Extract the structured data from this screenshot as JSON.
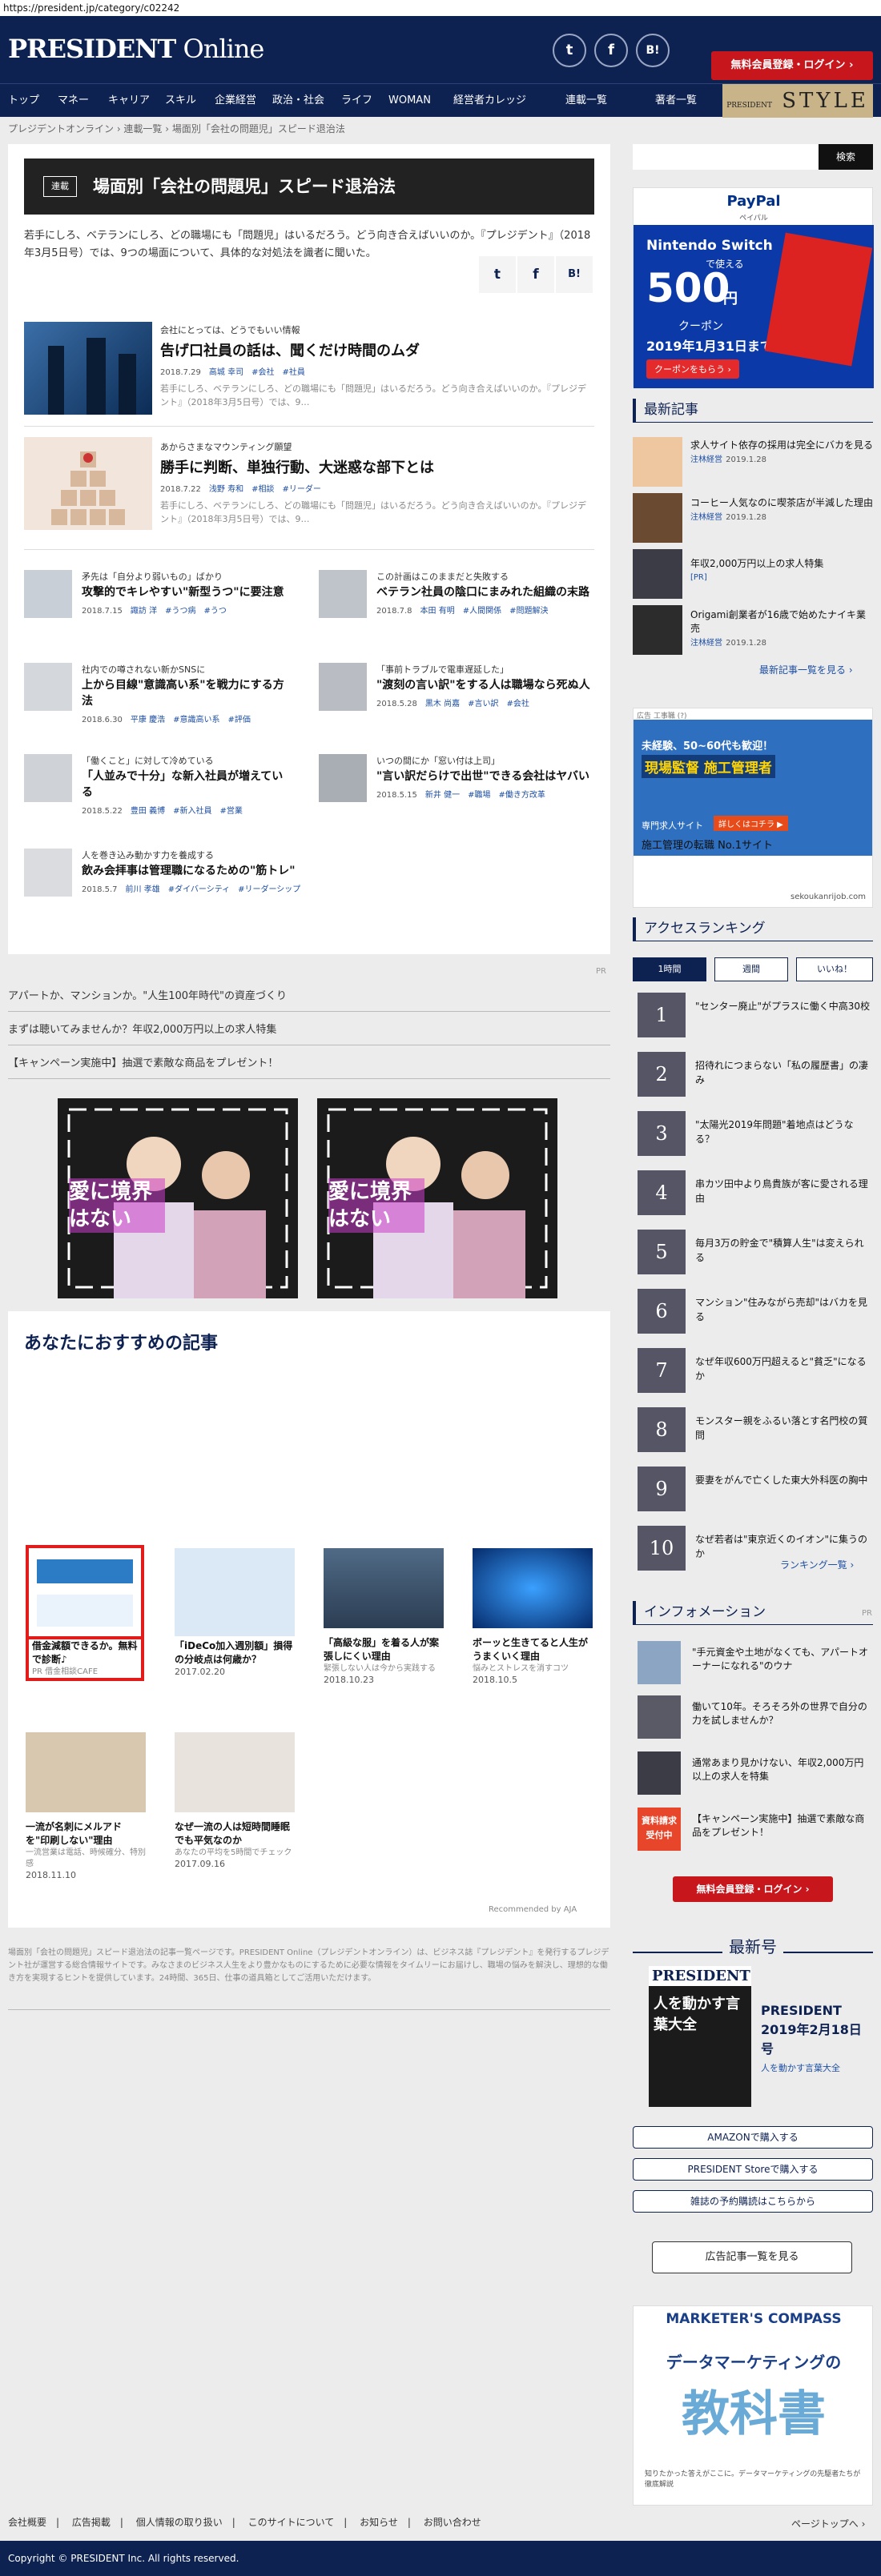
{
  "url": "https://president.jp/category/c02242",
  "header": {
    "logo_bold": "PRESIDENT",
    "logo_rest": " Online",
    "social": [
      "t",
      "f",
      "B!"
    ],
    "register": "無料会員登録・ログイン ›"
  },
  "nav": {
    "items": [
      "トップ",
      "マネー",
      "キャリア",
      "スキル",
      "企業経営",
      "政治・社会",
      "ライフ",
      "WOMAN",
      "経営者カレッジ"
    ],
    "right": [
      "連載一覧",
      "著者一覧"
    ],
    "style_small": "PRESIDENT",
    "style": "STYLE"
  },
  "breadcrumb": "プレジデントオンライン › 連載一覧 › 場面別「会社の問題児」スピード退治法",
  "series": {
    "badge": "連載",
    "title": "場面別「会社の問題児」スピード退治法",
    "lead": "若手にしろ、ベテランにしろ、どの職場にも「問題児」はいるだろう。どう向き合えばいいのか。『プレジデント』（2018年3月5日号）では、9つの場面について、具体的な対処法を識者に聞いた。",
    "share": [
      "t",
      "f",
      "B!"
    ]
  },
  "big_articles": [
    {
      "kicker": "会社にとっては、どうでもいい情報",
      "title": "告げ口社員の話は、聞くだけ時間のムダ",
      "date": "2018.7.29",
      "author": "高城 幸司",
      "tags": [
        "#会社",
        "#社員"
      ],
      "excerpt": "若手にしろ、ベテランにしろ、どの職場にも「問題児」はいるだろう。どう向き合えばいいのか。『プレジデント』（2018年3月5日号）では、9…"
    },
    {
      "kicker": "あからさまなマウンティング願望",
      "title": "勝手に判断、単独行動、大迷惑な部下とは",
      "date": "2018.7.22",
      "author": "浅野 寿和",
      "tags": [
        "#相談",
        "#リーダー"
      ],
      "excerpt": "若手にしろ、ベテランにしろ、どの職場にも「問題児」はいるだろう。どう向き合えばいいのか。『プレジデント』（2018年3月5日号）では、9…"
    }
  ],
  "small_articles": [
    {
      "kicker": "矛先は「自分より弱いもの」ばかり",
      "title": "攻撃的でキレやすい\"新型うつ\"に要注意",
      "date": "2018.7.15",
      "author": "諏訪 洋",
      "tags": [
        "#うつ病",
        "#うつ"
      ]
    },
    {
      "kicker": "この計画はこのままだと失敗する",
      "title": "ベテラン社員の陰口にまみれた組織の末路",
      "date": "2018.7.8",
      "author": "本田 有明",
      "tags": [
        "#人間関係",
        "#問題解決"
      ]
    },
    {
      "kicker": "社内での噂されない新かSNSに",
      "title": "上から目線\"意識高い系\"を戦力にする方法",
      "date": "2018.6.30",
      "author": "平康 慶浩",
      "tags": [
        "#意識高い系",
        "#評価"
      ]
    },
    {
      "kicker": "「事前トラブルで電車遅延した」",
      "title": "\"渡刻の言い訳\"をする人は職場なら死ぬ人",
      "date": "2018.5.28",
      "author": "黒木 尚嘉",
      "tags": [
        "#言い訳",
        "#会社"
      ]
    },
    {
      "kicker": "「働くこと」に対して冷めている",
      "title": "「人並みで十分」な新入社員が増えている",
      "date": "2018.5.22",
      "author": "豊田 義博",
      "tags": [
        "#新入社員",
        "#営業"
      ]
    },
    {
      "kicker": "いつの間にか「窓い付は上司」",
      "title": "\"言い訳だらけで出世\"できる会社はヤバい",
      "date": "2018.5.15",
      "author": "新井 健一",
      "tags": [
        "#職場",
        "#働き方改革"
      ]
    },
    {
      "kicker": "人を巻き込み動かす力を養成する",
      "title": "飲み会拝事は管理職になるための\"筋トレ\"",
      "date": "2018.5.7",
      "author": "前川 孝雄",
      "tags": [
        "#ダイバーシティ",
        "#リーダーシップ"
      ]
    }
  ],
  "pr_label": "PR",
  "pr_rows": [
    "アパートか、マンションか。\"人生100年時代\"の資産づくり",
    "まずは聴いてみませんか？年収2,000万円以上の求人特集",
    "【キャンペーン実施中】抽選で素敵な商品をプレゼント！"
  ],
  "banner_text": "愛に境界はない",
  "recommend": {
    "title": "あなたにおすすめの記事",
    "items": [
      {
        "caption": "借金減額できるか。無料で診断♪",
        "sub": "PR 借金相談CAFE",
        "date": ""
      },
      {
        "caption": "「iDeCo加入週別額」損得の分岐点は何歳か？",
        "sub": "",
        "date": "2017.02.20"
      },
      {
        "caption": "「高級な服」を着る人が案張しにくい理由",
        "sub": "緊張しない人は今から実践する",
        "date": "2018.10.23"
      },
      {
        "caption": "ボーッと生きてると人生がうまくいく理由",
        "sub": "悩みとストレスを消すコツ",
        "date": "2018.10.5"
      },
      {
        "caption": "一流が名刺にメルアドを\"印刷しない\"理由",
        "sub": "一流営業は電話、時候確分、特別感",
        "date": "2018.11.10"
      },
      {
        "caption": "なぜ一流の人は短時間睡眠でも平気なのか",
        "sub": "あなたの平均を5時間でチェック",
        "date": "2017.09.16"
      }
    ],
    "credit": "Recommended by AJA"
  },
  "desc": "場面別「会社の問題児」スピード退治法の記事一覧ページです。PRESIDENT Online（プレジデントオンライン）は、ビジネス誌『プレジデント』を発行するプレジデント社が運営する総合情報サイトです。みなさまのビジネス人生をより豊かなものにするために必要な情報をタイムリーにお届けし、職場の悩みを解決し、理想的な働き方を実現するヒントを提供しています。24時間、365日、仕事の道具箱としてご活用いただけます。",
  "side": {
    "search_btn": "検索",
    "ad1": {
      "brand": "PayPal",
      "sub": "ペイパル",
      "line1": "Nintendo Switch",
      "line2": "で使える",
      "amount": "500",
      "unit": "円",
      "coupon": "クーポン",
      "until": "2019年1月31日まで",
      "cta": "クーポンをもらう ›"
    },
    "news_title": "最新記事",
    "news": [
      {
        "title": "求人サイト依存の採用は完全にバカを見る",
        "author": "注林経営",
        "date": "2019.1.28"
      },
      {
        "title": "コーヒー人気なのに喫茶店が半減した理由",
        "author": "注林経営",
        "date": "2019.1.28"
      },
      {
        "title": "年収2,000万円以上の求人特集",
        "author": "[PR]",
        "date": ""
      },
      {
        "title": "Origami創業者が16歳で始めたナイキ業売",
        "author": "注林経営",
        "date": "2019.1.28"
      }
    ],
    "news_more": "最新記事一覧を見る ›",
    "ad2": {
      "label": "広告 工事職 (?)",
      "l1": "未経験、50~60代も歓迎！",
      "l2": "現場監督 施工管理者",
      "l3": "専門求人サイト",
      "cta": "詳しくはコチラ ▶",
      "foot": "施工管理の転職 No.1サイト",
      "url": "sekoukanrijob.com"
    },
    "rank_title": "アクセスランキング",
    "rank_tabs": [
      "1時間",
      "週間",
      "いいね！"
    ],
    "ranking": [
      "\"センター廃止\"がプラスに働く中高30校",
      "招待れにつまらない「私の履歴書」の凄み",
      "\"太陽光2019年問題\"着地点はどうなる？",
      "串カツ田中より鳥貴族が客に愛される理由",
      "毎月3万の貯金で\"積算人生\"は変えられる",
      "マンション\"住みながら売却\"はバカを見る",
      "なぜ年収600万円超えると\"貧乏\"になるか",
      "モンスター親をふるい落とす名門校の質問",
      "要妻をがんで亡くした東大外科医の胸中",
      "なぜ若者は\"東京近くのイオン\"に集うのか"
    ],
    "rank_more": "ランキング一覧 ›",
    "info_title": "インフォメーション",
    "info_pr": "PR",
    "info": [
      "\"手元資金や土地がなくても、アパートオーナーになれる\"のウナ",
      "働いて10年。そろそろ外の世界で自分の力を試しませんか？",
      "通常あまり見かけない、年収2,000万円以上の求人を特集",
      "【キャンペーン実施中】抽選で素敵な商品をプレゼント！"
    ],
    "info_badge": "資料請求受付中",
    "register": "無料会員登録・ログイン ›",
    "latest_title": "最新号",
    "mag": {
      "name": "PRESIDENT",
      "issue": "2019年2月18日号",
      "feature": "人を動かす言葉大全",
      "cover_text": "人を動かす言葉大全"
    },
    "buy": [
      "AMAZONで購入する",
      "PRESIDENT Storeで購入する",
      "雑誌の予約購読はこちらから"
    ],
    "ad_list": "広告記事一覧を見る",
    "ad3": {
      "brand": "MARKETER'S COMPASS",
      "l1": "データマーケティングの",
      "l2": "教科書",
      "foot": "知りたかった答えがここに。データマーケティングの先駆者たちが徹底解説"
    }
  },
  "footer": {
    "links": [
      "会社概要",
      "広告掲載",
      "個人情報の取り扱い",
      "このサイトについて",
      "お知らせ",
      "お問い合わせ"
    ],
    "top": "ページトップへ ›",
    "copyright": "Copyright © PRESIDENT Inc. All rights reserved."
  },
  "colors": {
    "navy": "#0e2252",
    "red": "#c8161d",
    "link": "#1e4fa2",
    "gold": "#c9b48a"
  }
}
